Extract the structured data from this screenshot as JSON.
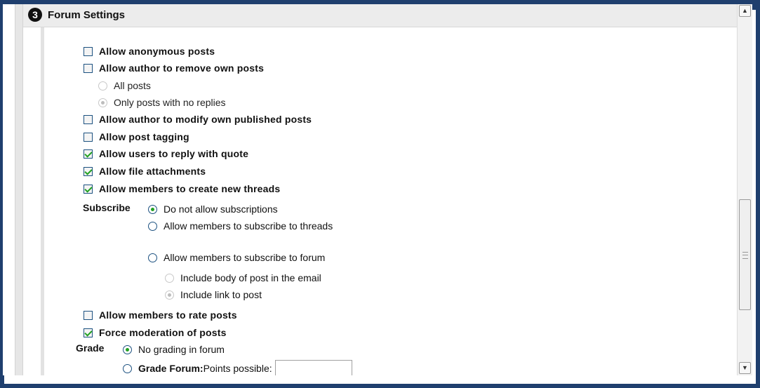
{
  "section": {
    "step_number": "3",
    "title": "Forum Settings"
  },
  "options": {
    "anonymous": {
      "label": "Allow anonymous posts",
      "checked": false
    },
    "remove_own": {
      "label": "Allow author to remove own posts",
      "checked": false
    },
    "remove_all": {
      "label": "All posts",
      "selected": false
    },
    "remove_no_replies": {
      "label": "Only posts with no replies",
      "selected": true
    },
    "modify_own": {
      "label": "Allow author to modify own published posts",
      "checked": false
    },
    "tagging": {
      "label": "Allow post tagging",
      "checked": false
    },
    "reply_quote": {
      "label": "Allow users to reply with quote",
      "checked": true
    },
    "attachments": {
      "label": "Allow file attachments",
      "checked": true
    },
    "new_threads": {
      "label": "Allow members to create new threads",
      "checked": true
    },
    "rate_posts": {
      "label": "Allow members to rate posts",
      "checked": false
    },
    "moderation": {
      "label": "Force moderation of posts",
      "checked": true
    }
  },
  "subscribe": {
    "label": "Subscribe",
    "none": {
      "label": "Do not allow subscriptions",
      "selected": true
    },
    "threads": {
      "label": "Allow members to subscribe to threads",
      "selected": false
    },
    "forum": {
      "label": "Allow members to subscribe to forum",
      "selected": false
    },
    "include_body": {
      "label": "Include body of post in the email",
      "selected": false
    },
    "include_link": {
      "label": "Include link to post",
      "selected": true
    }
  },
  "grade": {
    "label": "Grade",
    "no_grading": {
      "label": "No grading in forum",
      "selected": true
    },
    "grade_forum_bold": "Grade Forum:",
    "grade_forum_rest": " Points possible:",
    "points_value": ""
  },
  "colors": {
    "frame": "#1f3f6e",
    "check": "#21a121",
    "header_bg": "#ececec"
  }
}
